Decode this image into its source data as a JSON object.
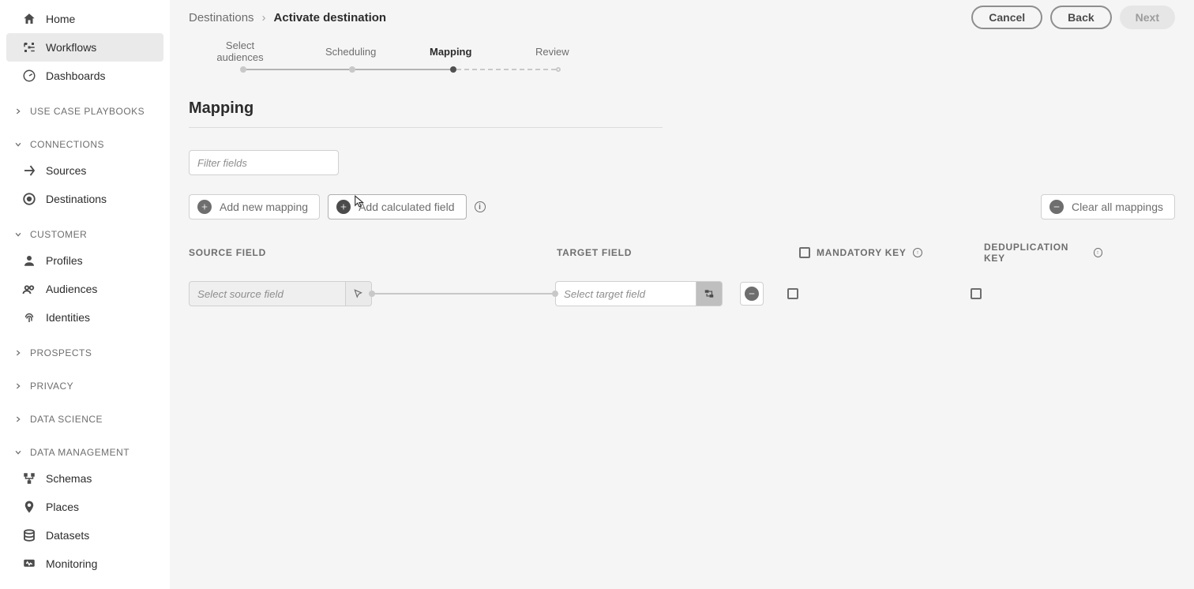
{
  "sidebar": {
    "items_top": [
      {
        "label": "Home",
        "icon": "home"
      },
      {
        "label": "Workflows",
        "icon": "bracket"
      },
      {
        "label": "Dashboards",
        "icon": "gauge"
      }
    ],
    "section_usecase": "Use Case Playbooks",
    "section_connections": "Connections",
    "items_connections": [
      {
        "label": "Sources"
      },
      {
        "label": "Destinations"
      }
    ],
    "section_customer": "Customer",
    "items_customer": [
      {
        "label": "Profiles"
      },
      {
        "label": "Audiences"
      },
      {
        "label": "Identities"
      }
    ],
    "section_prospects": "Prospects",
    "section_privacy": "Privacy",
    "section_datasci": "Data Science",
    "section_datamgmt": "Data Management",
    "items_datamgmt": [
      {
        "label": "Schemas"
      },
      {
        "label": "Places"
      },
      {
        "label": "Datasets"
      },
      {
        "label": "Monitoring"
      }
    ]
  },
  "breadcrumb": {
    "root": "Destinations",
    "current": "Activate destination"
  },
  "actions": {
    "cancel": "Cancel",
    "back": "Back",
    "next": "Next"
  },
  "steps": {
    "s1": "Select audiences",
    "s2": "Scheduling",
    "s3": "Mapping",
    "s4": "Review"
  },
  "page": {
    "title": "Mapping",
    "filter_placeholder": "Filter fields"
  },
  "toolbar": {
    "add_mapping": "Add new mapping",
    "add_calc": "Add calculated field",
    "clear": "Clear all mappings"
  },
  "tableHeaders": {
    "source": "Source Field",
    "target": "Target Field",
    "mandatory": "Mandatory Key",
    "dedup": "Deduplication Key"
  },
  "row1": {
    "source_placeholder": "Select source field",
    "target_placeholder": "Select target field"
  }
}
